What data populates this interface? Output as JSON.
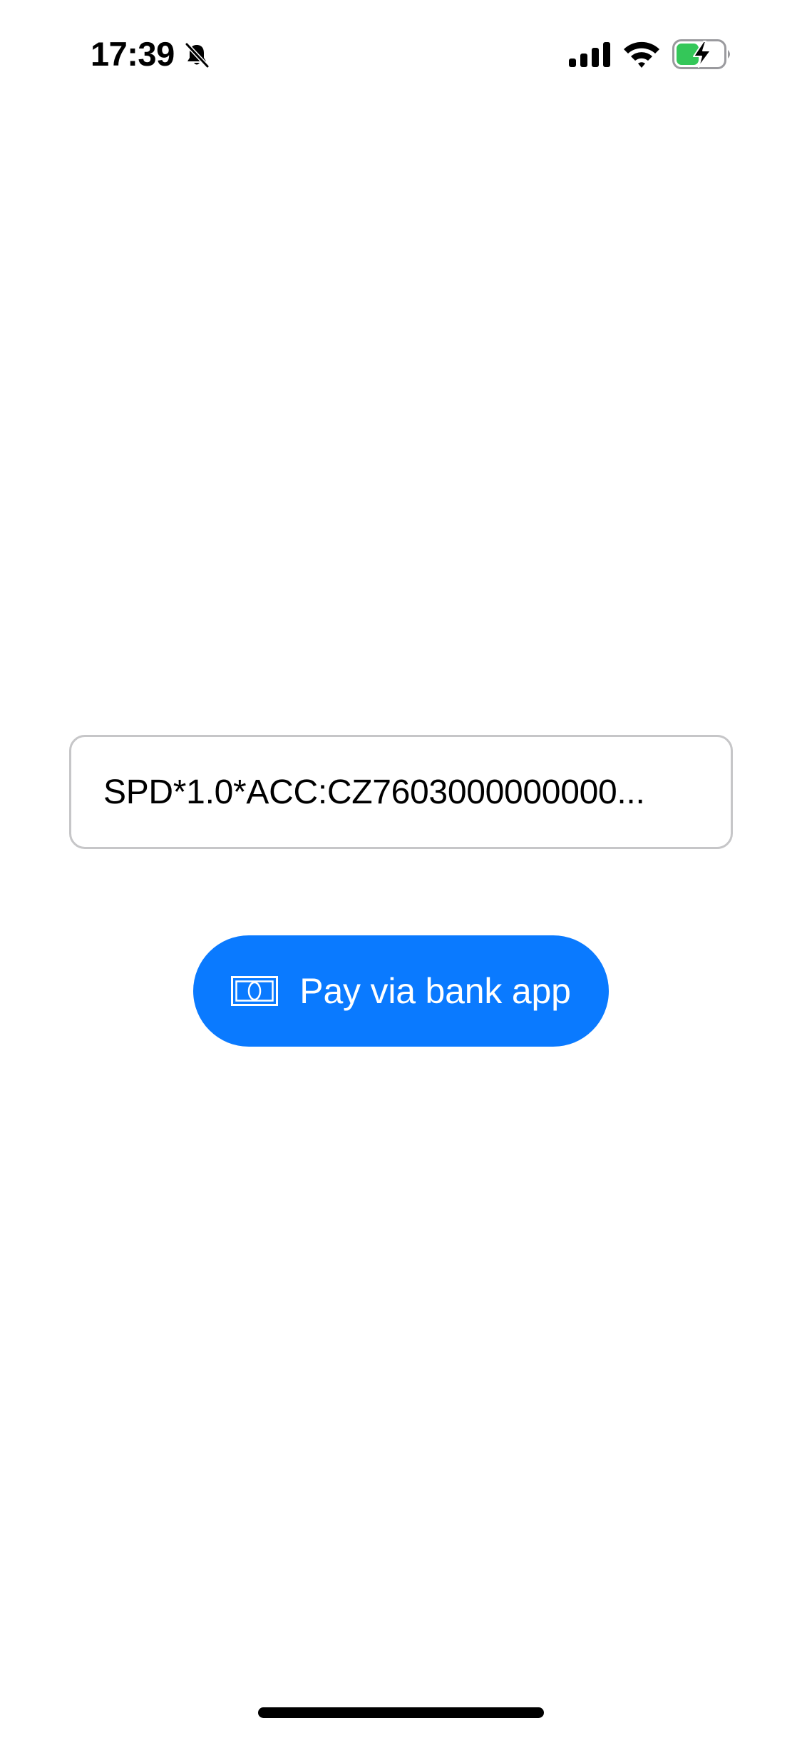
{
  "status_bar": {
    "time": "17:39",
    "icons": {
      "mute": "bell-slash-icon",
      "signal": "cellular-signal-icon",
      "wifi": "wifi-icon",
      "battery": "battery-charging-icon"
    },
    "battery_color": "#34c759"
  },
  "payment_field": {
    "value": "SPD*1.0*ACC:CZ7603000000000..."
  },
  "pay_button": {
    "icon": "banknote-icon",
    "label": "Pay via bank app",
    "color": "#0a7aff"
  }
}
